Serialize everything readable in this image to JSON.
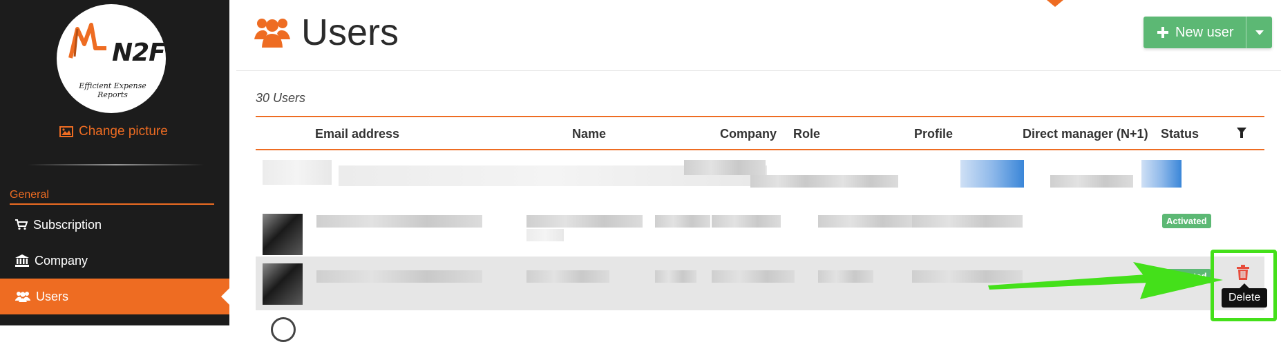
{
  "sidebar": {
    "logo": {
      "brand": "N2F",
      "tagline": "Efficient Expense Reports"
    },
    "change_picture_label": "Change picture",
    "section_label": "General",
    "items": [
      {
        "label": "Subscription",
        "icon": "cart-icon",
        "active": false
      },
      {
        "label": "Company",
        "icon": "bank-icon",
        "active": false
      },
      {
        "label": "Users",
        "icon": "users-icon",
        "active": true
      }
    ]
  },
  "header": {
    "title": "Users",
    "icon": "users-icon",
    "new_user_label": "New user"
  },
  "table": {
    "count_label": "30 Users",
    "columns": [
      "Email address",
      "Name",
      "Company",
      "Role",
      "Profile",
      "Direct manager (N+1)",
      "Status"
    ],
    "rows": [
      {
        "status": ""
      },
      {
        "status": "Activated"
      },
      {
        "status": "Activated"
      }
    ]
  },
  "row_actions": {
    "delete_icon": "trash-icon",
    "delete_tooltip": "Delete"
  },
  "colors": {
    "accent": "#ee6c22",
    "sidebar_bg": "#1c1c1c",
    "success": "#5cb874",
    "annotation": "#44e01a"
  }
}
